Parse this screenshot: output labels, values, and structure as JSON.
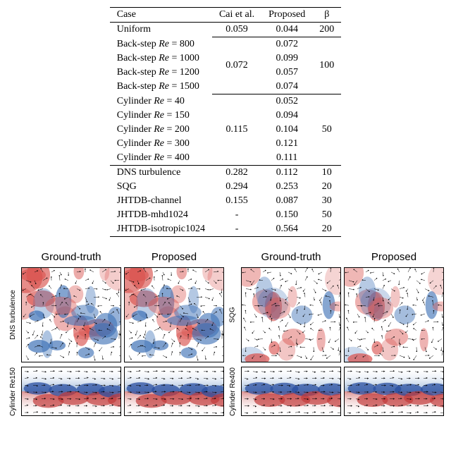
{
  "table": {
    "headers": [
      "Case",
      "Cai et al.",
      "Proposed",
      "β"
    ],
    "groups": [
      {
        "cai": "0.059",
        "beta": "200",
        "rows": [
          {
            "case": "Uniform",
            "proposed": "0.044"
          }
        ]
      },
      {
        "cai": "0.072",
        "beta": "100",
        "rows": [
          {
            "case": "Back-step Re = 800",
            "proposed": "0.072"
          },
          {
            "case": "Back-step Re = 1000",
            "proposed": "0.099"
          },
          {
            "case": "Back-step Re = 1200",
            "proposed": "0.057"
          },
          {
            "case": "Back-step Re = 1500",
            "proposed": "0.074"
          }
        ]
      },
      {
        "cai": "0.115",
        "beta": "50",
        "rows": [
          {
            "case": "Cylinder Re = 40",
            "proposed": "0.052"
          },
          {
            "case": "Cylinder Re = 150",
            "proposed": "0.094"
          },
          {
            "case": "Cylinder Re = 200",
            "proposed": "0.104"
          },
          {
            "case": "Cylinder Re = 300",
            "proposed": "0.121"
          },
          {
            "case": "Cylinder Re = 400",
            "proposed": "0.111"
          }
        ]
      }
    ],
    "singles": [
      {
        "case": "DNS turbulence",
        "cai": "0.282",
        "proposed": "0.112",
        "beta": "10"
      },
      {
        "case": "SQG",
        "cai": "0.294",
        "proposed": "0.253",
        "beta": "20"
      },
      {
        "case": "JHTDB-channel",
        "cai": "0.155",
        "proposed": "0.087",
        "beta": "30"
      },
      {
        "case": "JHTDB-mhd1024",
        "cai": "-",
        "proposed": "0.150",
        "beta": "50"
      },
      {
        "case": "JHTDB-isotropic1024",
        "cai": "-",
        "proposed": "0.564",
        "beta": "20"
      }
    ]
  },
  "figure": {
    "col_headers": [
      "Ground-truth",
      "Proposed",
      "Ground-truth",
      "Proposed"
    ],
    "row_labels": {
      "top_left": "DNS turbulence",
      "top_right": "SQG",
      "bot_left": "Cylinder Re150",
      "bot_right": "Cylinder Re400"
    }
  },
  "chart_data": [
    {
      "type": "heatmap",
      "title": "DNS turbulence (Ground-truth vs Proposed)",
      "description": "2D vorticity field with overlaid velocity vectors; red=positive, blue=negative vorticity, diverging colormap on white background",
      "panels": 2
    },
    {
      "type": "heatmap",
      "title": "SQG (Ground-truth vs Proposed)",
      "description": "2D buoyancy/vorticity field with overlaid velocity vectors; red/blue diverging colormap",
      "panels": 2
    },
    {
      "type": "heatmap",
      "title": "Cylinder Re150 (Ground-truth vs Proposed)",
      "description": "Wake vorticity behind cylinder, red/blue shear layers with velocity quiver",
      "panels": 2
    },
    {
      "type": "heatmap",
      "title": "Cylinder Re400 (Ground-truth vs Proposed)",
      "description": "Wake vorticity behind cylinder at higher Re, red/blue shear layers with velocity quiver",
      "panels": 2
    }
  ]
}
